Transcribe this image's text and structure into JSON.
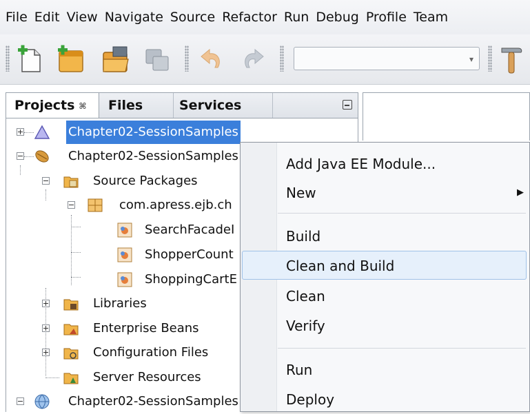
{
  "menubar": {
    "items": [
      "File",
      "Edit",
      "View",
      "Navigate",
      "Source",
      "Refactor",
      "Run",
      "Debug",
      "Profile",
      "Team"
    ]
  },
  "toolbar": {
    "icons": [
      "new-file-icon",
      "new-project-icon",
      "open-project-icon",
      "close-project-icon",
      "undo-icon",
      "redo-icon",
      "build-hammer-icon"
    ],
    "config_combo_value": ""
  },
  "panel": {
    "tabs": [
      {
        "label": "Projects",
        "active": true
      },
      {
        "label": "Files",
        "active": false
      },
      {
        "label": "Services",
        "active": false
      }
    ],
    "close_glyph": "⌘"
  },
  "tree": {
    "nodes": [
      {
        "label": "Chapter02-SessionSamples",
        "icon": "ejb-module-icon",
        "selected": true
      },
      {
        "label": "Chapter02-SessionSamples",
        "icon": "enterprise-app-icon",
        "selected": false
      },
      {
        "label": "Source Packages",
        "icon": "source-packages-icon"
      },
      {
        "label": "com.apress.ejb.ch",
        "icon": "package-icon"
      },
      {
        "label": "SearchFacadeI",
        "icon": "java-class-icon"
      },
      {
        "label": "ShopperCount",
        "icon": "java-class-icon"
      },
      {
        "label": "ShoppingCartE",
        "icon": "java-class-icon"
      },
      {
        "label": "Libraries",
        "icon": "libraries-icon"
      },
      {
        "label": "Enterprise Beans",
        "icon": "enterprise-beans-icon"
      },
      {
        "label": "Configuration Files",
        "icon": "config-files-icon"
      },
      {
        "label": "Server Resources",
        "icon": "server-resources-icon"
      },
      {
        "label": "Chapter02-SessionSamples",
        "icon": "web-module-icon"
      }
    ]
  },
  "context_menu": {
    "items": [
      {
        "label": "Add Java EE Module..."
      },
      {
        "label": "New",
        "submenu": true
      },
      {
        "label": "Build"
      },
      {
        "label": "Clean and Build",
        "highlighted": true
      },
      {
        "label": "Clean"
      },
      {
        "label": "Verify"
      },
      {
        "label": "Run"
      },
      {
        "label": "Deploy"
      }
    ],
    "submenu_arrow": "▶"
  },
  "colors": {
    "selection": "#3b7fdb",
    "menu_highlight": "#e6f0fb"
  }
}
